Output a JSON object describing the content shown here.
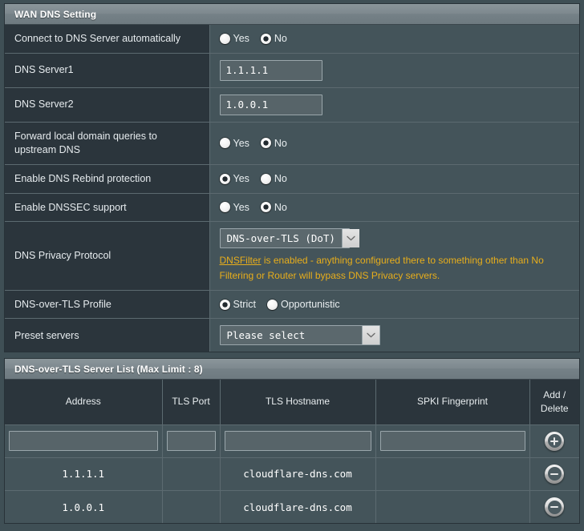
{
  "theme": {
    "page_background": "#3f4f55",
    "header_gradient_top": "#8b969b",
    "header_gradient_bottom": "#6e7a80",
    "label_cell_bg": "#2b353c",
    "value_cell_bg": "#44545a",
    "input_bg": "#576469",
    "input_border": "#9aa6ab",
    "warning_text": "#e8ae1b",
    "text_primary": "#ffffff"
  },
  "wan_dns": {
    "section_title": "WAN DNS Setting",
    "rows": {
      "connect_auto": {
        "label": "Connect to DNS Server automatically",
        "options": [
          {
            "label": "Yes",
            "selected": false
          },
          {
            "label": "No",
            "selected": true
          }
        ]
      },
      "dns_server1": {
        "label": "DNS Server1",
        "value": "1.1.1.1",
        "placeholder": ""
      },
      "dns_server2": {
        "label": "DNS Server2",
        "value": "1.0.0.1",
        "placeholder": ""
      },
      "forward_local": {
        "label": "Forward local domain queries to upstream DNS",
        "options": [
          {
            "label": "Yes",
            "selected": false
          },
          {
            "label": "No",
            "selected": true
          }
        ]
      },
      "dns_rebind": {
        "label": "Enable DNS Rebind protection",
        "options": [
          {
            "label": "Yes",
            "selected": true
          },
          {
            "label": "No",
            "selected": false
          }
        ]
      },
      "dnssec": {
        "label": "Enable DNSSEC support",
        "options": [
          {
            "label": "Yes",
            "selected": false
          },
          {
            "label": "No",
            "selected": true
          }
        ]
      },
      "privacy_protocol": {
        "label": "DNS Privacy Protocol",
        "selected_value": "DNS-over-TLS (DoT)",
        "dropdown_icon": "chevron-down-icon",
        "warning_link_text": "DNSFilter",
        "warning_text": " is enabled - anything configured there to something other than No Filtering or Router will bypass DNS Privacy servers."
      },
      "dot_profile": {
        "label": "DNS-over-TLS Profile",
        "options": [
          {
            "label": "Strict",
            "selected": true
          },
          {
            "label": "Opportunistic",
            "selected": false
          }
        ]
      },
      "preset_servers": {
        "label": "Preset servers",
        "selected_value": "Please select",
        "dropdown_icon": "chevron-down-icon"
      }
    }
  },
  "server_list": {
    "section_title": "DNS-over-TLS Server List (Max Limit : 8)",
    "columns": [
      {
        "header": "Address"
      },
      {
        "header": "TLS Port"
      },
      {
        "header": "TLS Hostname"
      },
      {
        "header": "SPKI Fingerprint"
      },
      {
        "header_line1": "Add /",
        "header_line2": "Delete"
      }
    ],
    "new_row": {
      "address": "",
      "tls_port": "",
      "tls_hostname": "",
      "spki_fingerprint": "",
      "action_icon": "plus-icon"
    },
    "rows": [
      {
        "address": "1.1.1.1",
        "tls_port": "",
        "tls_hostname": "cloudflare-dns.com",
        "spki_fingerprint": "",
        "action_icon": "minus-icon"
      },
      {
        "address": "1.0.0.1",
        "tls_port": "",
        "tls_hostname": "cloudflare-dns.com",
        "spki_fingerprint": "",
        "action_icon": "minus-icon"
      }
    ]
  }
}
